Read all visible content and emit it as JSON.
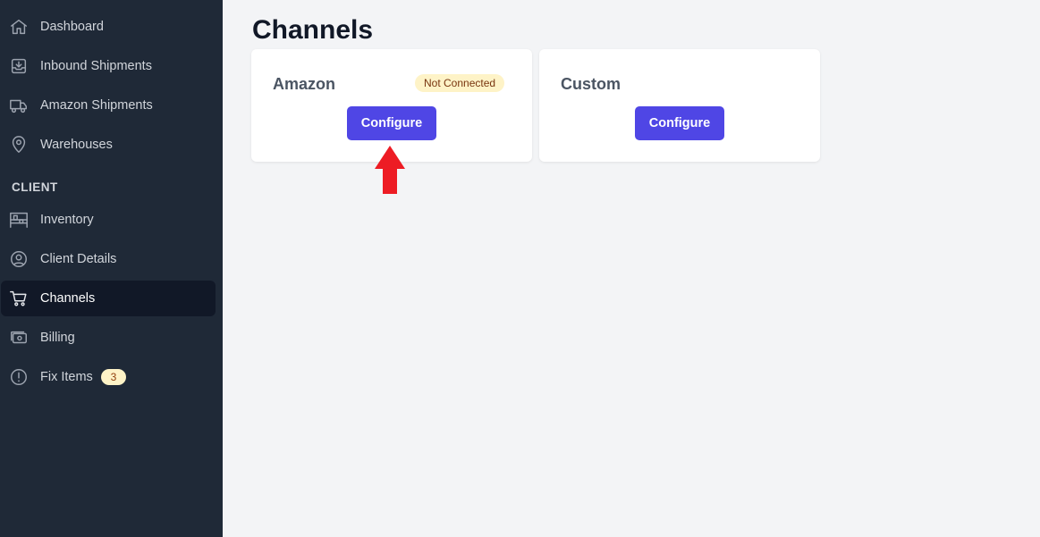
{
  "sidebar": {
    "items": [
      {
        "label": "Dashboard",
        "icon": "home-icon"
      },
      {
        "label": "Inbound Shipments",
        "icon": "inbox-download-icon"
      },
      {
        "label": "Amazon Shipments",
        "icon": "truck-icon"
      },
      {
        "label": "Warehouses",
        "icon": "map-pin-icon"
      }
    ],
    "section_label": "CLIENT",
    "client_items": [
      {
        "label": "Inventory",
        "icon": "warehouse-shelves-icon"
      },
      {
        "label": "Client Details",
        "icon": "user-circle-icon"
      },
      {
        "label": "Channels",
        "icon": "shopping-cart-icon",
        "active": true
      },
      {
        "label": "Billing",
        "icon": "cash-icon"
      },
      {
        "label": "Fix Items",
        "icon": "exclamation-circle-icon",
        "badge": "3"
      }
    ]
  },
  "main": {
    "title": "Channels",
    "cards": [
      {
        "name": "Amazon",
        "status": "Not Connected",
        "button": "Configure"
      },
      {
        "name": "Custom",
        "button": "Configure"
      }
    ]
  },
  "colors": {
    "sidebar_bg": "#1f2937",
    "active_bg": "#111827",
    "primary": "#4f46e5",
    "badge_bg": "#fef3c7",
    "annotation_arrow": "#ed1c24"
  }
}
